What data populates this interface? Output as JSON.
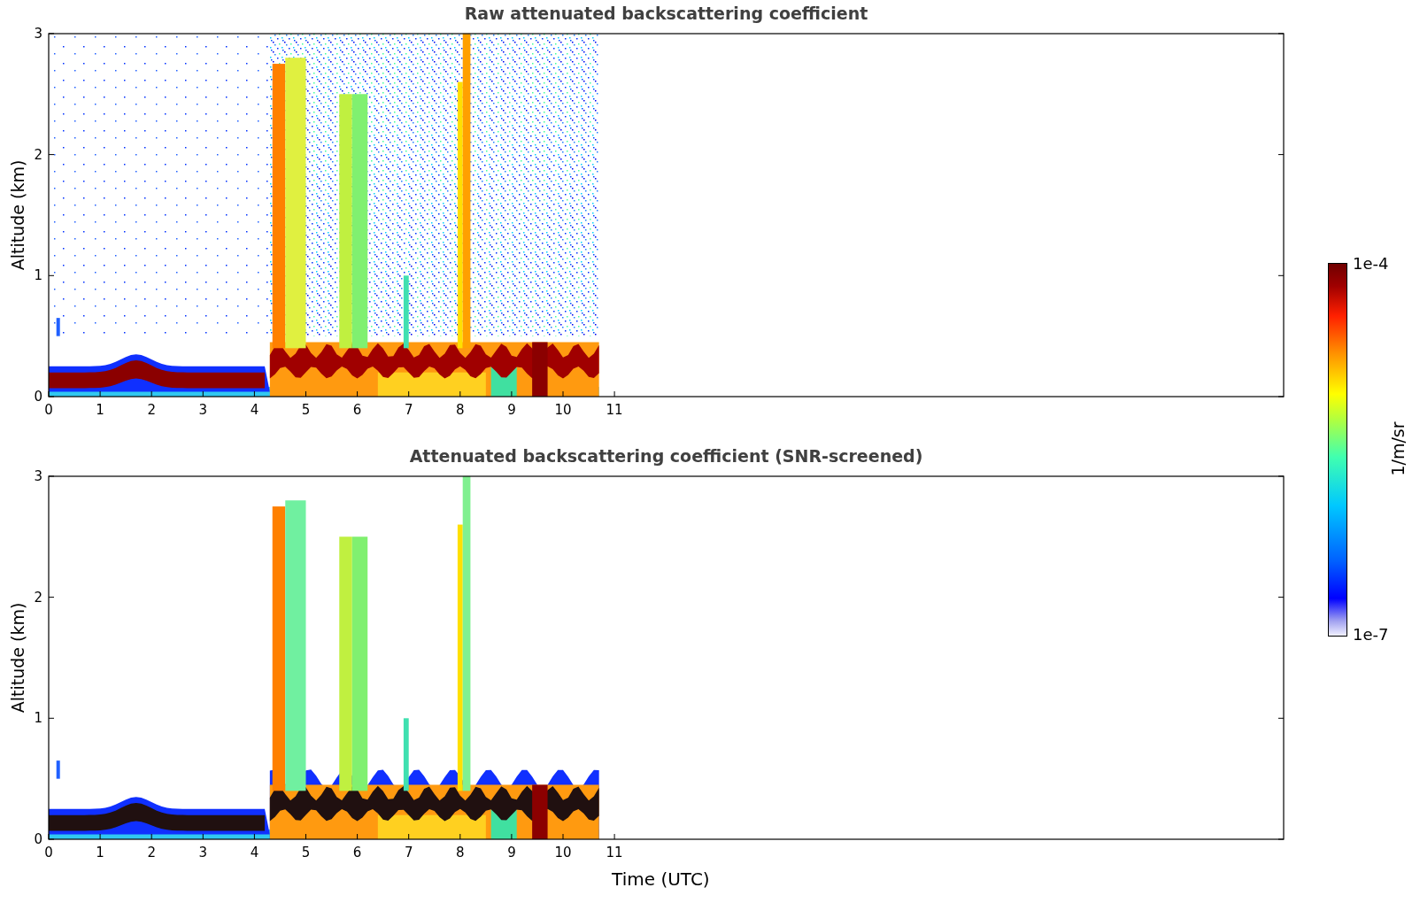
{
  "panels": [
    {
      "kind": "raw",
      "title": "Raw attenuated backscattering coefficient",
      "ylabel": "Altitude (km)",
      "yticks": [
        "3",
        "2",
        "1",
        "0"
      ],
      "xticks": [
        "0",
        "1",
        "2",
        "3",
        "4",
        "5",
        "6",
        "7",
        "8",
        "9",
        "10",
        "11"
      ]
    },
    {
      "kind": "screened",
      "title": "Attenuated backscattering coefficient (SNR-screened)",
      "ylabel": "Altitude (km)",
      "yticks": [
        "3",
        "2",
        "1",
        "0"
      ],
      "xticks": [
        "0",
        "1",
        "2",
        "3",
        "4",
        "5",
        "6",
        "7",
        "8",
        "9",
        "10",
        "11"
      ],
      "xlabel": "Time (UTC)"
    }
  ],
  "colorbar": {
    "max_label": "1e-4",
    "min_label": "1e-7",
    "unit": "1/m/sr"
  }
}
